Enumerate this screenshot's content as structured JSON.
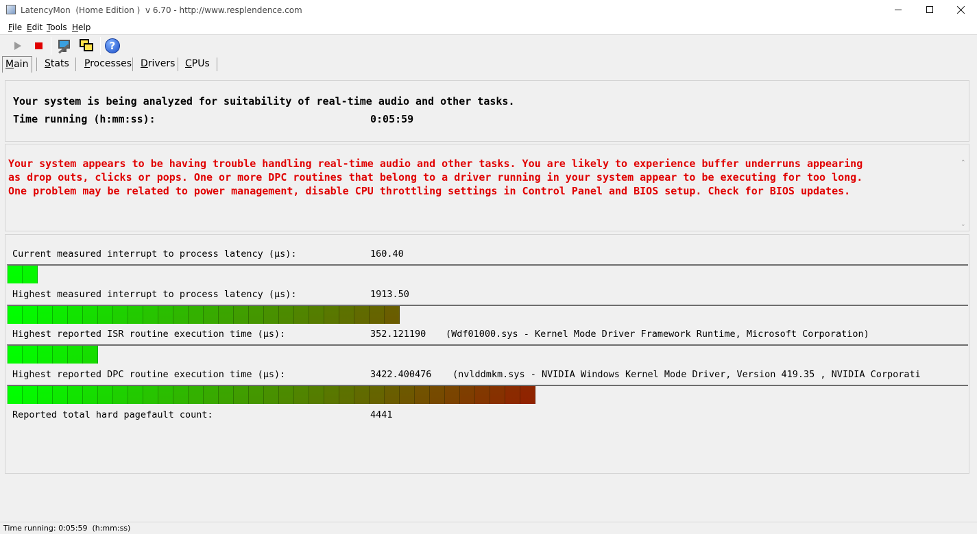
{
  "window": {
    "title": "LatencyMon  (Home Edition )  v 6.70 - http://www.resplendence.com"
  },
  "menu": [
    {
      "label_u": "F",
      "label_rest": "ile"
    },
    {
      "label_u": "E",
      "label_rest": "dit"
    },
    {
      "label_u": "T",
      "label_rest": "ools"
    },
    {
      "label_u": "H",
      "label_rest": "elp"
    }
  ],
  "toolbar": {
    "icons": [
      "play-icon",
      "stop-icon",
      "monitor-wand-icon",
      "windows-icon",
      "help-icon"
    ],
    "stop_color": "#e00000",
    "help_glyph": "?"
  },
  "tabs": [
    {
      "label_u": "M",
      "label_rest": "ain",
      "active": true
    },
    {
      "label_u": "S",
      "label_rest": "tats",
      "active": false
    },
    {
      "label_u": "P",
      "label_rest": "rocesses",
      "active": false
    },
    {
      "label_u": "D",
      "label_rest": "rivers",
      "active": false
    },
    {
      "label_u": "C",
      "label_rest": "PUs",
      "active": false
    }
  ],
  "status": {
    "line1": "Your system is being analyzed for suitability of real-time audio and other tasks.",
    "time_label": "Time running (h:mm:ss):",
    "time_value": "0:05:59"
  },
  "warning": {
    "color": "#e00000",
    "lines": [
      "Your system appears to be having trouble handling real-time audio and other tasks. You are likely to experience buffer underruns appearing",
      "as drop outs, clicks or pops. One or more DPC routines that belong to a driver running in your system appear to be executing for too long.",
      "One problem may be related to power management, disable CPU throttling settings in Control Panel and BIOS setup. Check for BIOS updates."
    ]
  },
  "metrics": {
    "current": {
      "label": "Current measured interrupt to process latency (µs):",
      "value": "160.40",
      "bar_fraction": 0.0285
    },
    "highest": {
      "label": "Highest measured interrupt to process latency (µs):",
      "value": "1913.50",
      "bar_fraction": 0.418
    },
    "isr": {
      "label": "Highest reported ISR routine execution time (µs):",
      "value": "352.121190",
      "detail": "(Wdf01000.sys - Kernel Mode Driver Framework Runtime, Microsoft Corporation)",
      "bar_fraction": 0.093
    },
    "dpc": {
      "label": "Highest reported DPC routine execution time (µs):",
      "value": "3422.400476",
      "detail": "(nvlddmkm.sys - NVIDIA Windows Kernel Mode Driver, Version 419.35 , NVIDIA Corporati",
      "bar_fraction": 0.548
    },
    "pagefault": {
      "label": "Reported total hard pagefault count:",
      "value": "4441"
    }
  },
  "statusbar": {
    "text": "Time running: 0:05:59  (h:mm:ss)"
  }
}
